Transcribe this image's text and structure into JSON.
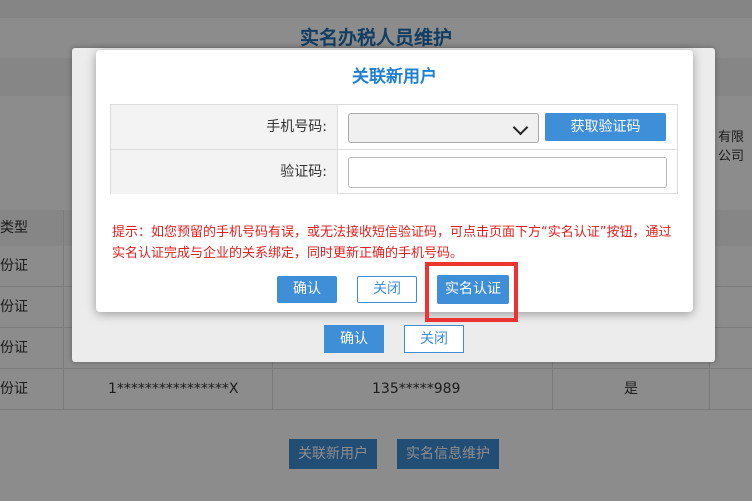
{
  "background": {
    "page_title": "实名办税人员维护",
    "company_snippet": "有限公司",
    "table_header_first": "类型",
    "row_types": [
      "份证",
      "份证",
      "份证",
      "份证"
    ],
    "last_row": {
      "id": "1****************X",
      "phone": "135*****989",
      "flag": "是"
    },
    "inner_confirm": "确认",
    "inner_close": "关闭",
    "bottom_buttons": {
      "link_user": "关联新用户",
      "info_maintain": "实名信息维护"
    }
  },
  "dialog": {
    "title": "关联新用户",
    "phone_label": "手机号码:",
    "phone_value": "",
    "get_code_button": "获取验证码",
    "code_label": "验证码:",
    "code_value": "",
    "hint": "提示：如您预留的手机号码有误，或无法接收短信验证码，可点击页面下方“实名认证”按钮，通过实名认证完成与企业的关系绑定，同时更新正确的手机号码。",
    "confirm_button": "确认",
    "close_button": "关闭",
    "realname_button": "实名认证"
  },
  "colors": {
    "primary": "#3f8ed8",
    "title": "#1f7fd0",
    "hint": "#e02020",
    "highlight": "#ee3333"
  }
}
